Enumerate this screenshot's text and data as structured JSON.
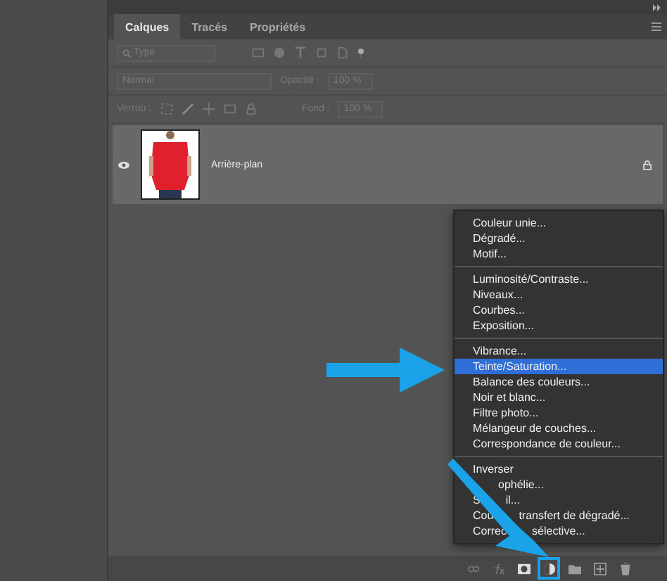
{
  "tabs": [
    {
      "label": "Calques",
      "selected": true
    },
    {
      "label": "Tracés",
      "selected": false
    },
    {
      "label": "Propriétés",
      "selected": false
    }
  ],
  "filter": {
    "placeholder": "Type"
  },
  "blend": {
    "mode": "Normal",
    "opacity_label": "Opacité :",
    "opacity": "100 %"
  },
  "lock": {
    "label": "Verrou :",
    "fill_label": "Fond :",
    "fill": "100 %"
  },
  "layers": [
    {
      "name": "Arrière-plan",
      "visible": true,
      "locked": true
    }
  ],
  "menu": {
    "sections": [
      [
        {
          "label": "Couleur unie...",
          "selected": false
        },
        {
          "label": "Dégradé...",
          "selected": false
        },
        {
          "label": "Motif...",
          "selected": false
        }
      ],
      [
        {
          "label": "Luminosité/Contraste...",
          "selected": false
        },
        {
          "label": "Niveaux...",
          "selected": false
        },
        {
          "label": "Courbes...",
          "selected": false
        },
        {
          "label": "Exposition...",
          "selected": false
        }
      ],
      [
        {
          "label": "Vibrance...",
          "selected": false
        },
        {
          "label": "Teinte/Saturation...",
          "selected": true
        },
        {
          "label": "Balance des couleurs...",
          "selected": false
        },
        {
          "label": "Noir et blanc...",
          "selected": false
        },
        {
          "label": "Filtre photo...",
          "selected": false
        },
        {
          "label": "Mélangeur de couches...",
          "selected": false
        },
        {
          "label": "Correspondance de couleur...",
          "selected": false
        }
      ],
      [
        {
          "label": "Inverser",
          "selected": false
        },
        {
          "after": "ophélie...",
          "selected": false
        },
        {
          "before": "S",
          "after": "il...",
          "selected": false
        },
        {
          "before": "Cou",
          "after": "transfert de dégradé...",
          "selected": false
        },
        {
          "before": "Correc",
          "after": "sélective...",
          "selected": false
        }
      ]
    ]
  },
  "footer_buttons": [
    {
      "kind": "link",
      "selected": false
    },
    {
      "kind": "fx",
      "selected": false
    },
    {
      "kind": "mask",
      "selected": false
    },
    {
      "kind": "adjustment",
      "selected": true
    },
    {
      "kind": "folder",
      "selected": false
    },
    {
      "kind": "new",
      "selected": false
    },
    {
      "kind": "trash",
      "selected": false
    }
  ]
}
